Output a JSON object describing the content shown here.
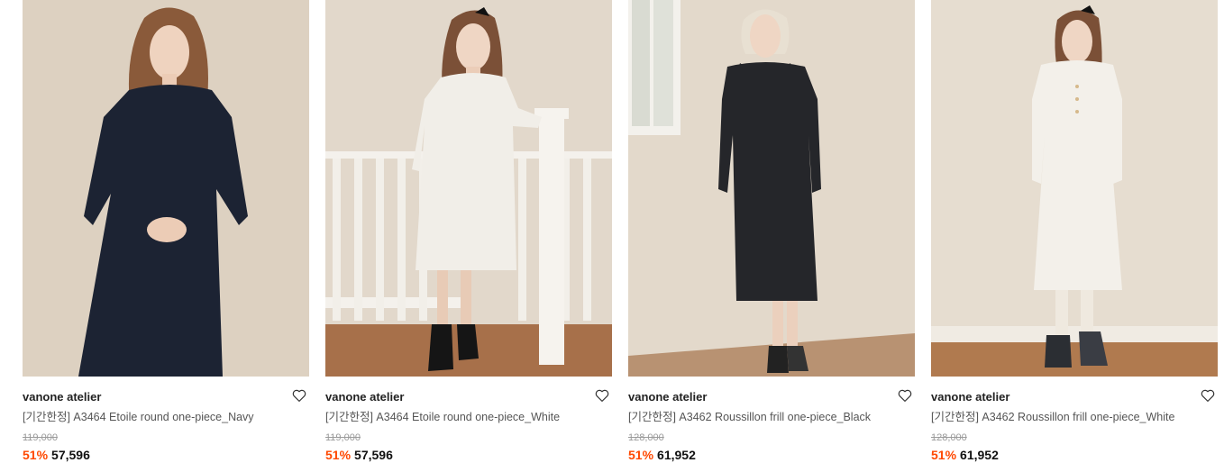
{
  "products": [
    {
      "brand": "vanone atelier",
      "name": "[기간한정] A3464 Etoile round one-piece_Navy",
      "original_price": "119,000",
      "discount": "51%",
      "price": "57,596",
      "dress_color": "#1c2333",
      "wall_color": "#ddd1c1",
      "floor_color": "#d6c9b6"
    },
    {
      "brand": "vanone atelier",
      "name": "[기간한정] A3464 Etoile round one-piece_White",
      "original_price": "119,000",
      "discount": "51%",
      "price": "57,596",
      "dress_color": "#f1eee8",
      "wall_color": "#e2d8cb",
      "floor_color": "#a7704a"
    },
    {
      "brand": "vanone atelier",
      "name": "[기간한정] A3462 Roussillon frill one-piece_Black",
      "original_price": "128,000",
      "discount": "51%",
      "price": "61,952",
      "dress_color": "#25262a",
      "wall_color": "#e3d9cb",
      "floor_color": "#b89272"
    },
    {
      "brand": "vanone atelier",
      "name": "[기간한정] A3462 Roussillon frill one-piece_White",
      "original_price": "128,000",
      "discount": "51%",
      "price": "61,952",
      "dress_color": "#f3f0ea",
      "wall_color": "#e6ddd0",
      "floor_color": "#b07a4f"
    }
  ],
  "icons": {
    "wishlist": "heart-outline-icon"
  },
  "colors": {
    "discount": "#ff4800",
    "text": "#222222",
    "muted": "#9a9a9a"
  }
}
